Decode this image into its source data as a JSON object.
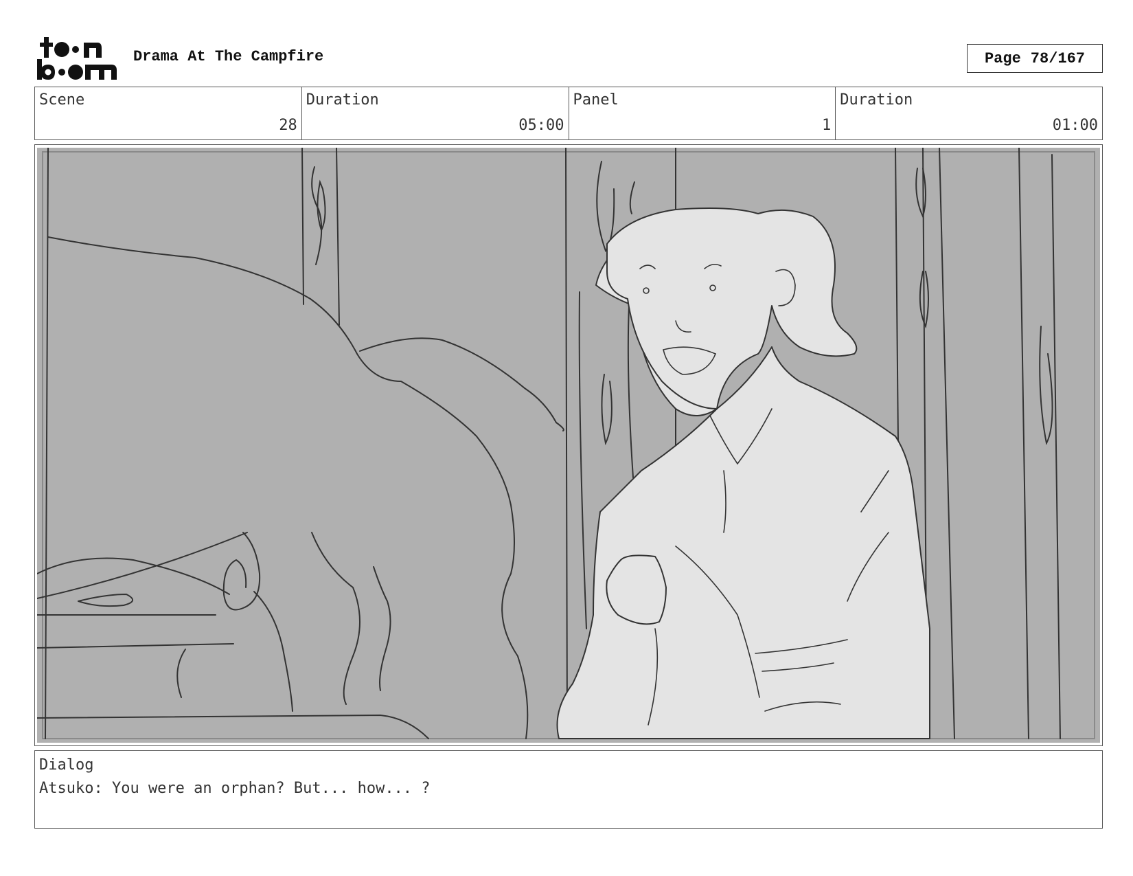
{
  "header": {
    "logo_text": "toon boom",
    "title": "Drama At The Campfire",
    "page_label": "Page",
    "page_number": "78/167"
  },
  "info": {
    "scene_label": "Scene",
    "scene_value": "28",
    "scene_duration_label": "Duration",
    "scene_duration_value": "05:00",
    "panel_label": "Panel",
    "panel_value": "1",
    "panel_duration_label": "Duration",
    "panel_duration_value": "01:00"
  },
  "panel_image": {
    "description_icon": "storyboard-sketch-image"
  },
  "dialog": {
    "label": "Dialog",
    "text": "Atsuko: You were an orphan? But... how... ?"
  }
}
